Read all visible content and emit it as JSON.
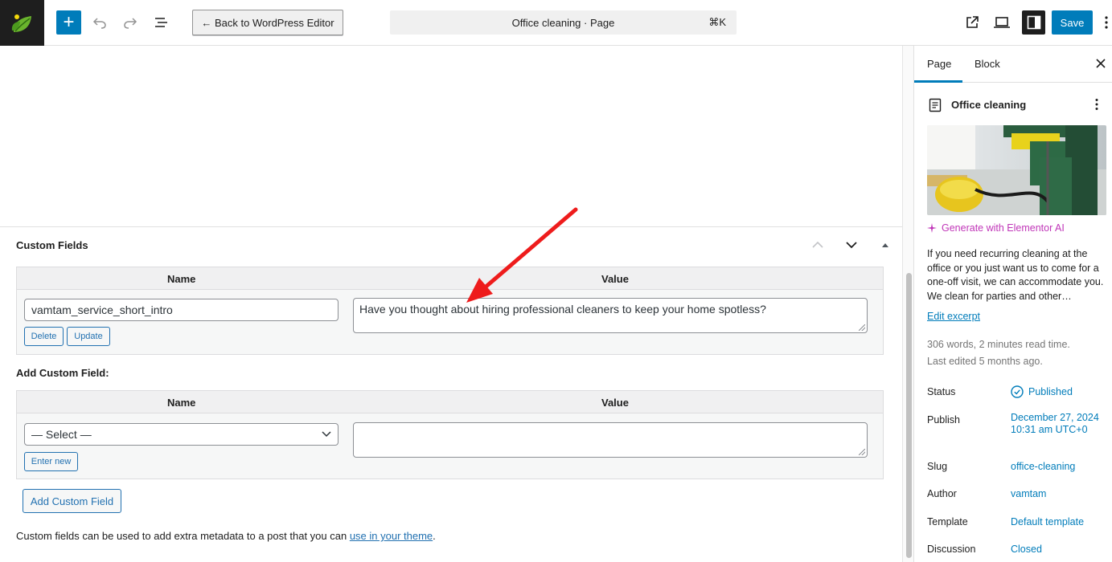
{
  "topbar": {
    "add_symbol": "+",
    "back_label": "← Back to WordPress Editor",
    "command_title": "Office cleaning · Page",
    "command_shortcut": "⌘K",
    "save_label": "Save"
  },
  "custom_fields": {
    "title": "Custom Fields",
    "table": {
      "col_name": "Name",
      "col_value": "Value",
      "rows": [
        {
          "name": "vamtam_service_short_intro",
          "value": "Have you thought about hiring professional cleaners to keep your home spotless?",
          "delete_label": "Delete",
          "update_label": "Update"
        }
      ]
    },
    "add_label": "Add Custom Field:",
    "add_table": {
      "col_name": "Name",
      "col_value": "Value",
      "select_value": "— Select —",
      "value_text": "",
      "enter_new_label": "Enter new"
    },
    "add_button_label": "Add Custom Field",
    "note_prefix": "Custom fields can be used to add extra metadata to a post that you can ",
    "note_link": "use in your theme",
    "note_suffix": "."
  },
  "sidebar": {
    "tabs": [
      {
        "label": "Page",
        "active": true
      },
      {
        "label": "Block",
        "active": false
      }
    ],
    "doc_title": "Office cleaning",
    "ai_link": "Generate with Elementor AI",
    "excerpt": "If you need recurring cleaning at the office or you just want us to come for a one-off visit, we can accommodate you. We clean for parties and other…",
    "edit_excerpt": "Edit excerpt",
    "word_count": "306 words, 2 minutes read time.",
    "last_edited": "Last edited 5 months ago.",
    "properties": [
      {
        "label": "Status",
        "value": "Published"
      },
      {
        "label": "Publish",
        "value": "December 27, 2024 10:31 am UTC+0"
      },
      {
        "label": "Slug",
        "value": "office-cleaning"
      },
      {
        "label": "Author",
        "value": "vamtam"
      },
      {
        "label": "Template",
        "value": "Default template"
      },
      {
        "label": "Discussion",
        "value": "Closed"
      }
    ]
  },
  "colors": {
    "accent": "#007cba",
    "annotation_arrow": "#ee1c1c",
    "ai_magenta": "#c036b8"
  }
}
